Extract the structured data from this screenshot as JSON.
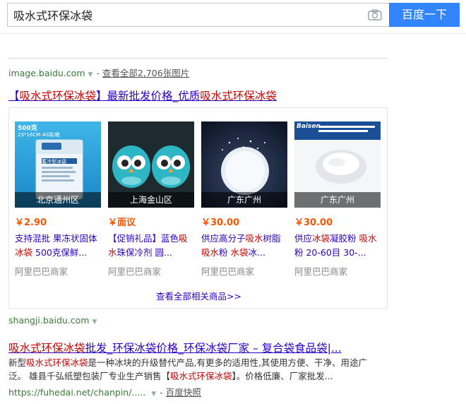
{
  "search": {
    "query": "吸水式环保冰袋",
    "button_label": "百度一下"
  },
  "image_result": {
    "source_domain": "image.baidu.com",
    "view_all_images": "查看全部2,706张图片",
    "title_prefix": "【",
    "title_keyword": "吸水式环保冰袋",
    "title_mid": "】最新批发价格_优质",
    "title_suffix": "吸水式环保冰袋",
    "products": [
      {
        "location": "北京通州区",
        "price": "￥2.90",
        "name_parts": [
          "支持混批 果冻状固体",
          "冰袋",
          " 500克保鲜..."
        ],
        "seller": "阿里巴巴商家",
        "thumb_label_top": "500克",
        "thumb_label_sub": "23*16CM  40袋/箱",
        "thumb_bag_text": "蓄冷型冰袋"
      },
      {
        "location": "上海金山区",
        "price": "￥面议",
        "name_parts": [
          "【促销礼品】蓝色",
          "吸水",
          "珠保冷剂 圆..."
        ],
        "seller": "阿里巴巴商家"
      },
      {
        "location": "广东广州",
        "price": "￥30.00",
        "name_parts": [
          "供应高分子",
          "吸水",
          "树脂 ",
          "吸水",
          "粉 ",
          "水袋",
          "冰..."
        ],
        "seller": "阿里巴巴商家"
      },
      {
        "location": "广东广州",
        "price": "￥30.00",
        "name_parts": [
          "供应",
          "冰袋",
          "凝胶粉 ",
          "吸水",
          "粉 20-60目 30-..."
        ],
        "seller": "阿里巴巴商家",
        "thumb_brand": "Baisen"
      }
    ],
    "view_all_products": "查看全部相关商品>>"
  },
  "shangji": {
    "domain": "shangji.baidu.com"
  },
  "result2": {
    "title_keyword": "吸水式环保冰袋",
    "title_rest": "批发_环保冰袋价格_环保冰袋厂家 – 复合袋食品袋|...",
    "desc_line1_a": "新型",
    "desc_line1_kw": "吸水式环保冰袋",
    "desc_line1_b": "是一种冰块的升级替代产品,有更多的适用性,其使用方便、干净、用途广",
    "desc_line2_a": "泛。 雄县千弘纸塑包装厂专业生产销售【",
    "desc_line2_kw": "吸水式环保冰袋",
    "desc_line2_b": "】。价格低廉、厂家批发...",
    "url": "https://fuhedai.net/chanpin/.....",
    "snapshot": "百度快照"
  }
}
